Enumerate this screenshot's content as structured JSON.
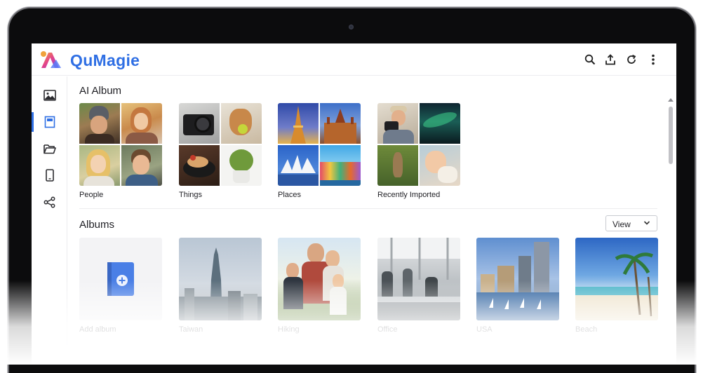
{
  "app": {
    "name": "QuMagie"
  },
  "header": {
    "icons": [
      "search-icon",
      "upload-icon",
      "refresh-icon",
      "more-vertical-icon"
    ]
  },
  "sidebar": {
    "items": [
      {
        "icon": "photos-icon",
        "active": false
      },
      {
        "icon": "albums-icon",
        "active": true
      },
      {
        "icon": "folder-icon",
        "active": false
      },
      {
        "icon": "mobile-device-icon",
        "active": false
      },
      {
        "icon": "share-icon",
        "active": false
      }
    ]
  },
  "ai_album": {
    "title": "AI Album",
    "cards": [
      {
        "label": "People"
      },
      {
        "label": "Things"
      },
      {
        "label": "Places"
      },
      {
        "label": "Recently Imported"
      }
    ]
  },
  "albums": {
    "title": "Albums",
    "view_label": "View",
    "items": [
      {
        "label": "Add album"
      },
      {
        "label": "Taiwan"
      },
      {
        "label": "Hiking"
      },
      {
        "label": "Office"
      },
      {
        "label": "USA"
      },
      {
        "label": "Beach"
      }
    ]
  },
  "colors": {
    "brand": "#2f6fe4",
    "text": "#1f1f24",
    "bezel": "#0c0c0d"
  }
}
